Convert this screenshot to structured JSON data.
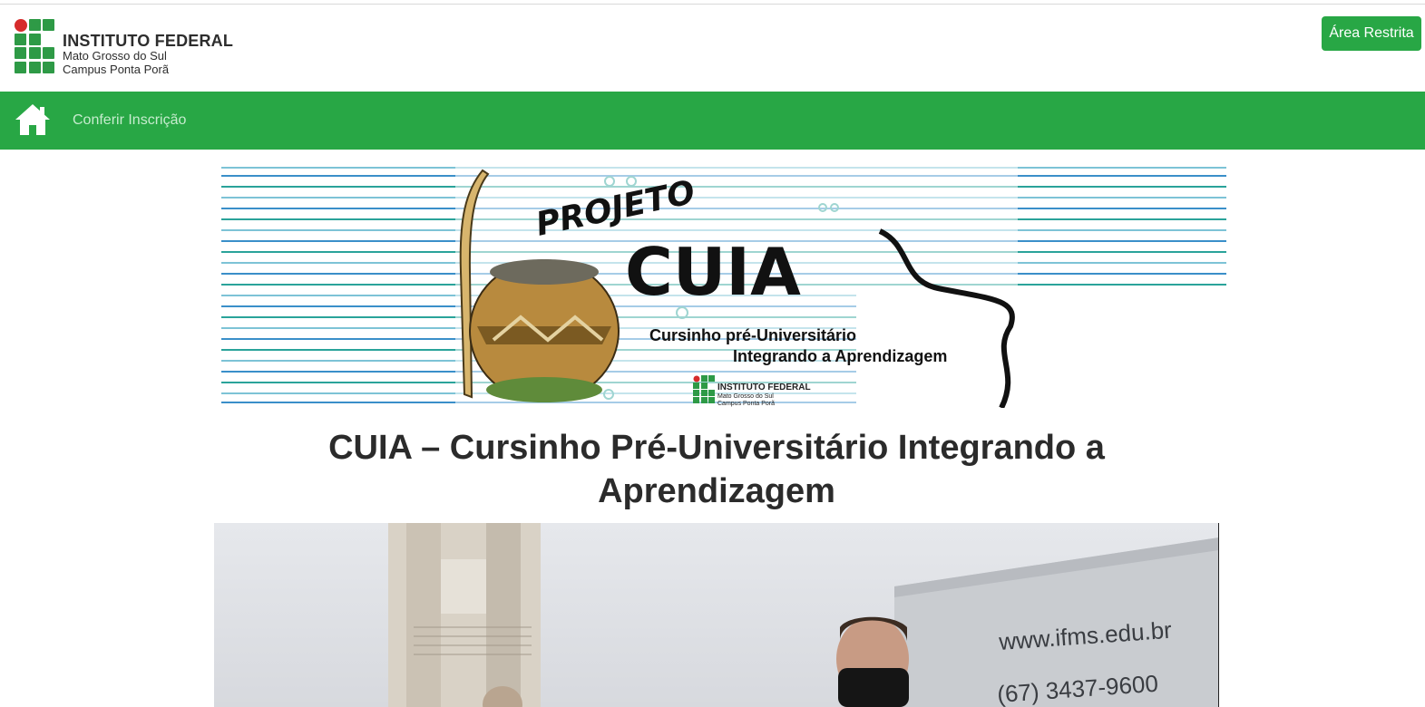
{
  "header": {
    "logo": {
      "line1": "INSTITUTO FEDERAL",
      "line2": "Mato Grosso do Sul",
      "line3": "Campus Ponta Porã"
    },
    "restricted_label": "Área Restrita"
  },
  "nav": {
    "home_icon": "home-icon",
    "items": [
      {
        "label": "Conferir Inscrição"
      }
    ]
  },
  "banner": {
    "title_top": "PROJETO",
    "title_main": "CUIA",
    "subtitle1": "Cursinho pré-Universitário",
    "subtitle2": "Integrando a Aprendizagem",
    "logo_line1": "INSTITUTO FEDERAL",
    "logo_line2": "Mato Grosso do Sul",
    "logo_line3": "Campus Ponta Porã"
  },
  "main": {
    "title": "CUIA – Cursinho Pré-Universitário Integrando a Aprendizagem"
  },
  "photo": {
    "sign_url": "www.ifms.edu.br",
    "sign_phone": "(67) 3437-9600"
  },
  "colors": {
    "brand_green": "#28a745",
    "logo_green": "#2e9a46",
    "logo_red": "#d62b2b",
    "nav_link": "#c6ecce"
  }
}
